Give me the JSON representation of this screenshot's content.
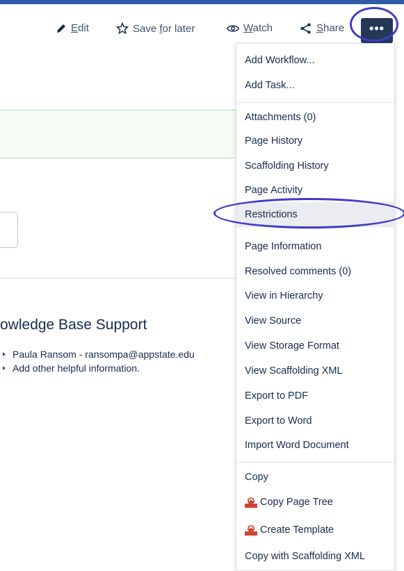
{
  "toolbar": {
    "edit_prefix": "",
    "edit_label_first": "E",
    "edit_label_rest": "dit",
    "save_label_a": "Save ",
    "save_label_b": "f",
    "save_label_c": "or later",
    "watch_label_a": "W",
    "watch_label_b": "atch",
    "share_label_a": "S",
    "share_label_b": "hare",
    "more_label": "•••"
  },
  "content": {
    "heading": "owledge Base Support",
    "list": [
      "Paula Ransom - ransompa@appstate.edu",
      "Add other helpful information."
    ]
  },
  "menu": {
    "items": [
      {
        "label": "Add Workflow..."
      },
      {
        "label": "Add Task..."
      },
      {
        "label": "Attachments (0)"
      },
      {
        "label": "Page History"
      },
      {
        "label": "Scaffolding History"
      },
      {
        "label": "Page Activity"
      },
      {
        "label": "Restrictions"
      },
      {
        "label": "Page Information"
      },
      {
        "label": "Resolved comments (0)"
      },
      {
        "label": "View in Hierarchy"
      },
      {
        "label": "View Source"
      },
      {
        "label": "View Storage Format"
      },
      {
        "label": "View Scaffolding XML"
      },
      {
        "label": "Export to PDF"
      },
      {
        "label": "Export to Word"
      },
      {
        "label": "Import Word Document"
      },
      {
        "label": "Copy"
      },
      {
        "label": "Copy Page Tree"
      },
      {
        "label": "Create Template"
      },
      {
        "label": "Copy with Scaffolding XML"
      }
    ]
  },
  "colors": {
    "accent_navy": "#253858",
    "annotation_circle": "#3e3cc7",
    "plugin_icon": "#d04437"
  }
}
